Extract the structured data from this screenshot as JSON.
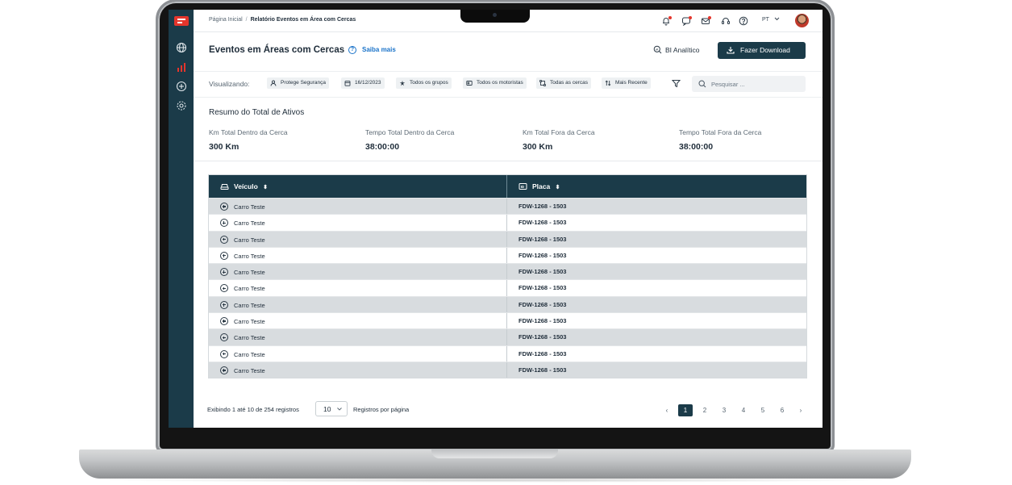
{
  "breadcrumb": {
    "home": "Página Inicial",
    "separator": "/",
    "current": "Relatório Eventos em Área com Cercas"
  },
  "topbar": {
    "language": "PT"
  },
  "header": {
    "title": "Eventos em Áreas com Cercas",
    "help_link": "Saiba mais",
    "help_icon": "?",
    "analytics_button": "BI Analítico",
    "download_button": "Fazer Download"
  },
  "filters": {
    "label": "Visualizando:",
    "chips": {
      "user": "Protege Segurança",
      "date": "16/12/2023",
      "groups": "Todos os grupos",
      "drivers": "Todos os motoristas",
      "fences": "Todas as cercas",
      "sort": "Mais Recente"
    },
    "search_placeholder": "Pesquisar ..."
  },
  "summary": {
    "title": "Resumo do Total de Ativos",
    "stats": [
      {
        "label": "Km Total Dentro da Cerca",
        "value": "300 Km"
      },
      {
        "label": "Tempo Total Dentro da Cerca",
        "value": "38:00:00"
      },
      {
        "label": "Km Total Fora da Cerca",
        "value": "300 Km"
      },
      {
        "label": "Tempo Total Fora da Cerca",
        "value": "38:00:00"
      }
    ]
  },
  "table": {
    "columns": {
      "vehicle": "Veículo",
      "plate": "Placa"
    },
    "rows": [
      {
        "vehicle": "Carro Teste",
        "plate": "FDW-1268 - 1503"
      },
      {
        "vehicle": "Carro Teste",
        "plate": "FDW-1268 - 1503"
      },
      {
        "vehicle": "Carro Teste",
        "plate": "FDW-1268 - 1503"
      },
      {
        "vehicle": "Carro Teste",
        "plate": "FDW-1268 - 1503"
      },
      {
        "vehicle": "Carro Teste",
        "plate": "FDW-1268 - 1503"
      },
      {
        "vehicle": "Carro Teste",
        "plate": "FDW-1268 - 1503"
      },
      {
        "vehicle": "Carro Teste",
        "plate": "FDW-1268 - 1503"
      },
      {
        "vehicle": "Carro Teste",
        "plate": "FDW-1268 - 1503"
      },
      {
        "vehicle": "Carro Teste",
        "plate": "FDW-1268 - 1503"
      },
      {
        "vehicle": "Carro Teste",
        "plate": "FDW-1268 - 1503"
      },
      {
        "vehicle": "Carro Teste",
        "plate": "FDW-1268 - 1503"
      }
    ]
  },
  "pagination": {
    "showing": "Exibindo 1 até 10 de 254 registros",
    "per_page_value": "10",
    "per_page_label": "Registros por página",
    "pages": [
      "1",
      "2",
      "3",
      "4",
      "5",
      "6"
    ],
    "active_page": "1",
    "prev": "‹",
    "next": "›"
  },
  "colors": {
    "primary": "#1b3b49",
    "accent": "#e5352c",
    "link": "#1a73c9"
  }
}
